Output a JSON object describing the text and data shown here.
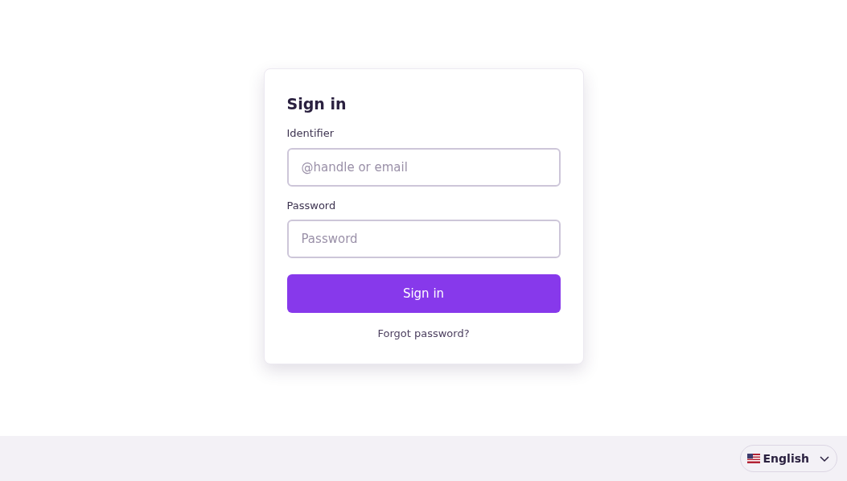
{
  "form": {
    "title": "Sign in",
    "fields": [
      {
        "label": "Identifier",
        "placeholder": "@handle or email"
      },
      {
        "label": "Password",
        "placeholder": "Password"
      }
    ],
    "submit": "Sign in",
    "forgot_link": "Forgot password?"
  },
  "footer": {
    "language": "English"
  }
}
